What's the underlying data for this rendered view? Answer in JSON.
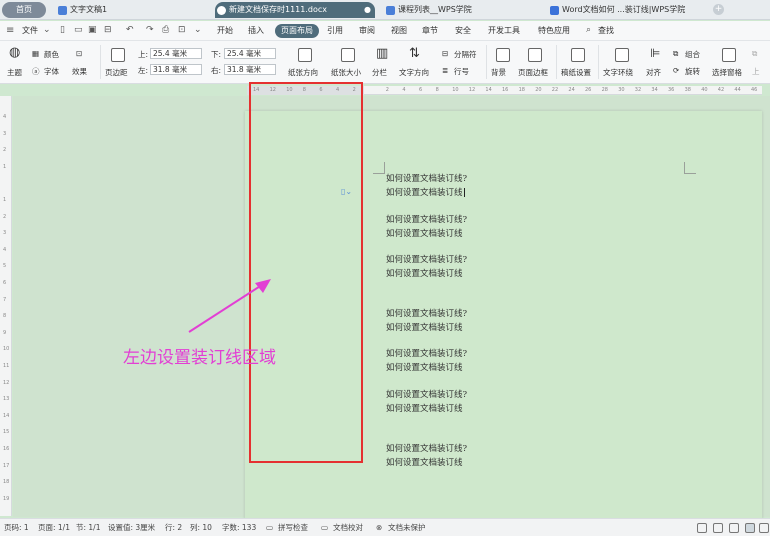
{
  "tabs": {
    "home": "首页",
    "items": [
      {
        "label": "文字文稿1",
        "icon_color": "#4a7fd8"
      },
      {
        "label": "新建文档保存时1111.docx",
        "icon_color": "#2e6dd6"
      },
      {
        "label": "课程列表__WPS学院",
        "icon_color": "#4a7fd8"
      },
      {
        "label": "Word文档如何 ...装订线|WPS学院",
        "icon_color": "#3b72d9"
      }
    ],
    "add": "+"
  },
  "menubar": {
    "file": "文件",
    "items": [
      "开始",
      "插入",
      "页面布局",
      "引用",
      "审阅",
      "视图",
      "章节",
      "安全",
      "开发工具",
      "特色应用"
    ],
    "active": "页面布局",
    "search": "查找"
  },
  "ribbon": {
    "theme": "主题",
    "color": "颜色",
    "font": "字体",
    "effect": "效果",
    "margins": "页边距",
    "margin_top_label": "上:",
    "margin_top": "25.4 毫米",
    "margin_bottom_label": "下:",
    "margin_bottom": "25.4 毫米",
    "margin_left_label": "左:",
    "margin_left": "31.8 毫米",
    "margin_right_label": "右:",
    "margin_right": "31.8 毫米",
    "orientation": "纸张方向",
    "size": "纸张大小",
    "columns": "分栏",
    "text_direction": "文字方向",
    "breaks": "分隔符",
    "line_numbers": "行号",
    "background": "背景",
    "page_border": "页面边框",
    "paper_setup": "稿纸设置",
    "text_wrap": "文字环绕",
    "align": "对齐",
    "group": "组合",
    "rotate": "旋转",
    "selection_pane": "选择窗格",
    "up": "上"
  },
  "ruler": {
    "h_ticks": [
      "14",
      "12",
      "10",
      "8",
      "6",
      "4",
      "2",
      "",
      "2",
      "4",
      "6",
      "8",
      "10",
      "12",
      "14",
      "16",
      "18",
      "20",
      "22",
      "24",
      "26",
      "28",
      "30",
      "32",
      "34",
      "36",
      "38",
      "40",
      "42",
      "44",
      "46"
    ],
    "v_ticks": [
      "4",
      "3",
      "2",
      "1",
      "",
      "1",
      "2",
      "3",
      "4",
      "5",
      "6",
      "7",
      "8",
      "9",
      "10",
      "11",
      "12",
      "13",
      "14",
      "15",
      "16",
      "17",
      "18",
      "19"
    ]
  },
  "document": {
    "paragraphs": [
      [
        "如何设置文档装订线?",
        "如何设置文档装订线"
      ],
      [
        "如何设置文档装订线?",
        "如何设置文档装订线"
      ],
      [
        "如何设置文档装订线?",
        "如何设置文档装订线"
      ],
      [
        "如何设置文档装订线?",
        "如何设置文档装订线"
      ],
      [
        "如何设置文档装订线?",
        "如何设置文档装订线"
      ],
      [
        "如何设置文档装订线?",
        "如何设置文档装订线"
      ],
      [
        "如何设置文档装订线?",
        "如何设置文档装订线"
      ]
    ]
  },
  "annotation": {
    "text": "左边设置装订线区域",
    "box_color": "#e53030",
    "text_color": "#e23fd4"
  },
  "status": {
    "page_no": "页码: 1",
    "pages": "页面: 1/1",
    "section": "节: 1/1",
    "setting": "设置值: 3厘米",
    "row": "行: 2",
    "col": "列: 10",
    "words": "字数: 133",
    "spellcheck": "拼写检查",
    "proofread": "文档校对",
    "protect": "文档未保护"
  }
}
